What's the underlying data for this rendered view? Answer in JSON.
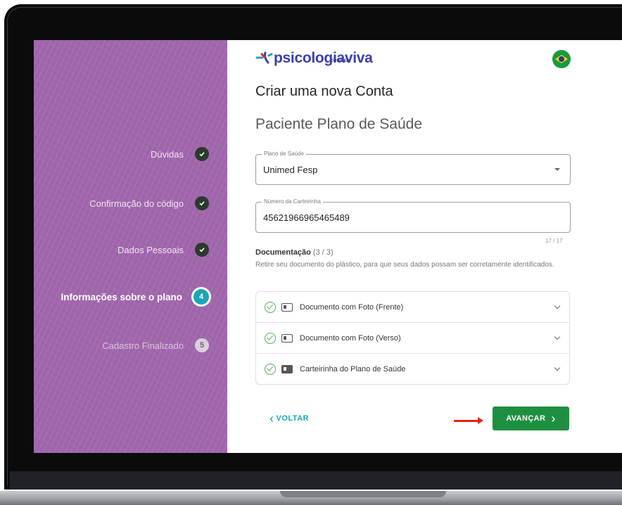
{
  "brand": {
    "name": "psicologiaviva",
    "sub": "conexa"
  },
  "header": {
    "title": "Criar uma nova Conta",
    "subtitle": "Paciente Plano de Saúde"
  },
  "steps": [
    {
      "label": "Dúvidas",
      "state": "done"
    },
    {
      "label": "Confirmação do código",
      "state": "done"
    },
    {
      "label": "Dados Pessoais",
      "state": "done"
    },
    {
      "label": "Informações sobre o plano",
      "state": "active",
      "number": "4"
    },
    {
      "label": "Cadastro Finalizado",
      "state": "pending",
      "number": "5"
    }
  ],
  "form": {
    "plan": {
      "legend": "Plano de Saúde",
      "value": "Unimed Fesp"
    },
    "card": {
      "legend": "Número da Carteirinha",
      "value": "45621966965465489",
      "counter": "17 / 17"
    }
  },
  "documents": {
    "heading": "Documentação",
    "count": "(3 / 3)",
    "instructions": "Retire seu documento do plástico, para que seus dados possam ser corretamente identificados.",
    "items": [
      {
        "label": "Documento com Foto (Frente)"
      },
      {
        "label": "Documento com Foto (Verso)"
      },
      {
        "label": "Carteirinha do Plano de Saúde"
      }
    ]
  },
  "actions": {
    "back": "VOLTAR",
    "next": "AVANÇAR"
  },
  "colors": {
    "sidebar": "#a066ab",
    "accent": "#1aa6b7",
    "primary": "#1e8f40",
    "arrow": "#e2231a"
  }
}
